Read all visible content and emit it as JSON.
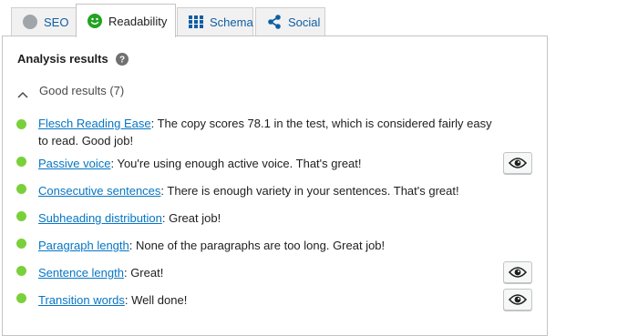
{
  "tabs": [
    {
      "label": "SEO",
      "icon": "seo-score-circle-icon"
    },
    {
      "label": "Readability",
      "icon": "smiley-face-icon"
    },
    {
      "label": "Schema",
      "icon": "grid-icon"
    },
    {
      "label": "Social",
      "icon": "share-icon"
    }
  ],
  "active_tab": "Readability",
  "panel": {
    "title": "Analysis results",
    "help_icon": "question-circle-icon",
    "section_toggle": "Good results (7)",
    "section_state": "expanded"
  },
  "results": [
    {
      "link": "Flesch Reading Ease",
      "text": ": The copy scores 78.1 in the test, which is considered fairly easy to read. Good job!",
      "status": "good",
      "has_eye": false
    },
    {
      "link": "Passive voice",
      "text": ": You're using enough active voice. That's great!",
      "status": "good",
      "has_eye": true
    },
    {
      "link": "Consecutive sentences",
      "text": ": There is enough variety in your sentences. That's great!",
      "status": "good",
      "has_eye": false
    },
    {
      "link": "Subheading distribution",
      "text": ": Great job!",
      "status": "good",
      "has_eye": false
    },
    {
      "link": "Paragraph length",
      "text": ": None of the paragraphs are too long. Great job!",
      "status": "good",
      "has_eye": false
    },
    {
      "link": "Sentence length",
      "text": ": Great!",
      "status": "good",
      "has_eye": true
    },
    {
      "link": "Transition words",
      "text": ": Well done!",
      "status": "good",
      "has_eye": true
    }
  ],
  "colors": {
    "good": "#7ad03a",
    "link": "#0675c4",
    "tab_link": "#0f5ea3",
    "smiley": "#22a322"
  }
}
